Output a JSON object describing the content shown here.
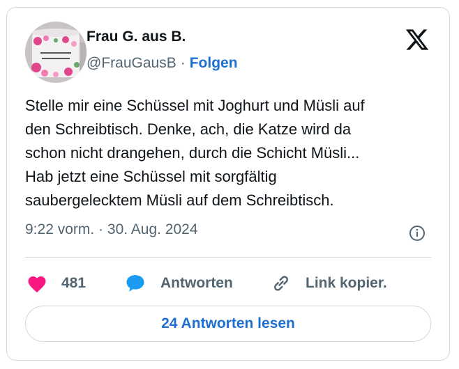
{
  "author": {
    "name": "Frau G. aus B.",
    "handle": "@FrauGausB",
    "separator": "·",
    "follow_label": "Folgen",
    "avatar_mug_text": "ICH BIN NUR ZUM FEIERN HIER"
  },
  "tweet": {
    "lines": [
      "Stelle mir eine Schüssel mit Joghurt und Müsli auf",
      "den Schreibtisch. Denke, ach, die Katze wird da",
      "schon nicht drangehen, durch die Schicht Müsli...",
      "Hab jetzt eine Schüssel mit sorgfältig",
      "saubergelecktem Müsli auf dem Schreibtisch."
    ],
    "time": "9:22 vorm.",
    "date_separator": "·",
    "date": "30. Aug. 2024"
  },
  "actions": {
    "like_count": "481",
    "reply_label": "Antworten",
    "copy_link_label": "Link kopier."
  },
  "read_replies_label": "24 Antworten lesen",
  "icons": {
    "platform": "x-logo-icon",
    "info": "info-icon",
    "like": "heart-icon",
    "reply": "speech-bubble-icon",
    "copy": "link-icon"
  },
  "colors": {
    "heart": "#f91880",
    "reply_bubble": "#1d9bf0",
    "link_blue": "#1d6fd1",
    "secondary_text": "#536471",
    "border": "#cfd9de"
  }
}
